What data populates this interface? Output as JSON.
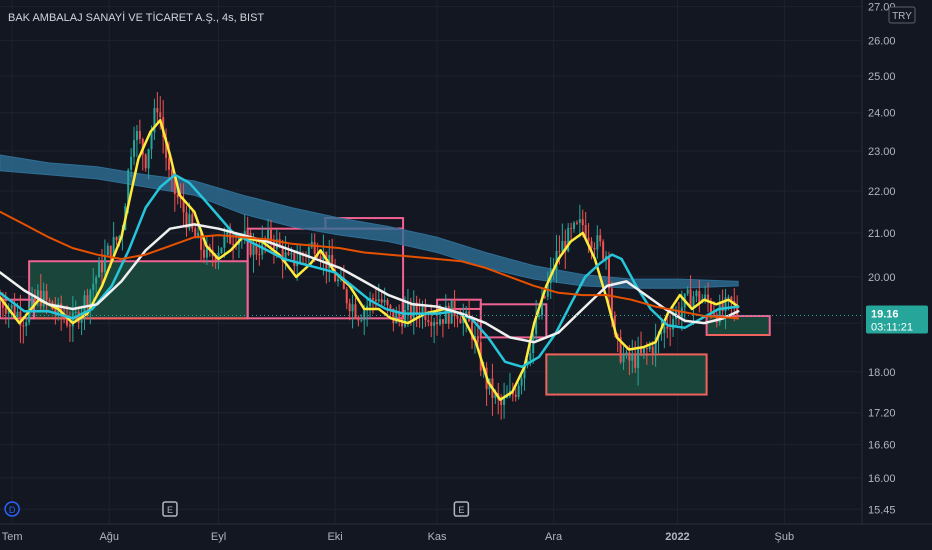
{
  "header": {
    "title": "BAK AMBALAJ SANAYİ VE TİCARET A.Ş., 4s, BIST",
    "currency": "TRY"
  },
  "price_badge": {
    "price": "19.16",
    "countdown": "03:11:21",
    "color": "#26a69a"
  },
  "event_markers": [
    {
      "label": "D",
      "time": 0.5,
      "color": "#2962ff"
    },
    {
      "label": "E",
      "time": 7.0,
      "color": "#b2b5be"
    },
    {
      "label": "E",
      "time": 19.0,
      "color": "#b2b5be"
    }
  ],
  "colors": {
    "background": "#131722",
    "grid": "#1e222d",
    "candle_up": "#26a69a",
    "candle_down": "#ef5350",
    "ma_yellow": "#ffeb3b",
    "ma_cyan": "#26c6da",
    "ma_white": "#f0f0f0",
    "ma_orange": "#e65100",
    "cloud": "#2e6f96",
    "zone_pink": "#f06292",
    "zone_red": "#f0625c",
    "zone_fill": "#1b4d3e"
  },
  "chart_data": {
    "type": "candlestick",
    "title": "BAK AMBALAJ SANAYİ VE TİCARET A.Ş., 4s, BIST",
    "y_scale": "log",
    "ylim": [
      15.2,
      27.2
    ],
    "xlim": [
      0,
      35.5
    ],
    "yticks": [
      "15.45",
      "16.00",
      "16.60",
      "17.20",
      "18.00",
      "19.00",
      "20.00",
      "21.00",
      "22.00",
      "23.00",
      "24.00",
      "25.00",
      "26.00",
      "27.00"
    ],
    "xticks": [
      {
        "label": "Tem",
        "x": 0.5
      },
      {
        "label": "Ağu",
        "x": 4.5
      },
      {
        "label": "Eyl",
        "x": 9.0
      },
      {
        "label": "Eki",
        "x": 13.8
      },
      {
        "label": "Kas",
        "x": 18.0
      },
      {
        "label": "Ara",
        "x": 22.8
      },
      {
        "label": "2022",
        "x": 27.9
      },
      {
        "label": "Şub",
        "x": 32.3
      }
    ],
    "grid": true,
    "last_price": 19.16,
    "ohlc_keypoints": [
      [
        0,
        19.5
      ],
      [
        1.0,
        19.1
      ],
      [
        1.6,
        19.6
      ],
      [
        2.4,
        19.2
      ],
      [
        3.0,
        19.0
      ],
      [
        3.6,
        19.6
      ],
      [
        4.4,
        20.5
      ],
      [
        5.0,
        21.0
      ],
      [
        5.5,
        23.6
      ],
      [
        6.0,
        22.8
      ],
      [
        6.5,
        24.3
      ],
      [
        7.0,
        22.2
      ],
      [
        7.5,
        21.6
      ],
      [
        8.0,
        20.9
      ],
      [
        8.6,
        20.4
      ],
      [
        9.2,
        20.8
      ],
      [
        9.8,
        21.0
      ],
      [
        10.5,
        20.6
      ],
      [
        11.2,
        20.9
      ],
      [
        11.9,
        20.3
      ],
      [
        12.5,
        20.5
      ],
      [
        13.0,
        20.8
      ],
      [
        13.5,
        20.3
      ],
      [
        14.2,
        19.6
      ],
      [
        14.8,
        19.2
      ],
      [
        15.5,
        19.6
      ],
      [
        16.2,
        19.1
      ],
      [
        16.8,
        19.2
      ],
      [
        17.4,
        19.3
      ],
      [
        18.0,
        19.1
      ],
      [
        18.8,
        19.3
      ],
      [
        19.4,
        18.9
      ],
      [
        20.0,
        17.8
      ],
      [
        20.6,
        17.3
      ],
      [
        21.2,
        17.6
      ],
      [
        21.8,
        18.5
      ],
      [
        22.4,
        19.5
      ],
      [
        23.0,
        20.6
      ],
      [
        23.6,
        21.0
      ],
      [
        24.0,
        21.2
      ],
      [
        24.5,
        20.8
      ],
      [
        25.0,
        20.5
      ],
      [
        25.3,
        18.6
      ],
      [
        25.8,
        18.2
      ],
      [
        26.4,
        18.3
      ],
      [
        27.0,
        18.6
      ],
      [
        27.5,
        19.0
      ],
      [
        28.0,
        19.3
      ],
      [
        28.5,
        19.6
      ],
      [
        29.0,
        19.5
      ],
      [
        29.6,
        19.2
      ],
      [
        30.1,
        19.4
      ],
      [
        30.4,
        19.2
      ]
    ],
    "series": [
      {
        "name": "",
        "color": "#ffeb3b",
        "points": [
          [
            0,
            19.55
          ],
          [
            0.8,
            19.0
          ],
          [
            1.6,
            19.5
          ],
          [
            2.4,
            19.3
          ],
          [
            3.0,
            19.0
          ],
          [
            3.6,
            19.2
          ],
          [
            4.2,
            19.8
          ],
          [
            5.0,
            20.9
          ],
          [
            5.7,
            22.8
          ],
          [
            6.2,
            23.5
          ],
          [
            6.6,
            23.8
          ],
          [
            7.0,
            22.9
          ],
          [
            7.4,
            21.9
          ],
          [
            8.0,
            21.5
          ],
          [
            8.5,
            20.7
          ],
          [
            9.0,
            20.4
          ],
          [
            9.5,
            20.6
          ],
          [
            10.0,
            20.9
          ],
          [
            10.8,
            20.8
          ],
          [
            11.5,
            20.5
          ],
          [
            12.2,
            20.0
          ],
          [
            12.8,
            20.3
          ],
          [
            13.2,
            20.6
          ],
          [
            13.8,
            20.1
          ],
          [
            14.4,
            19.8
          ],
          [
            15.0,
            19.3
          ],
          [
            15.6,
            19.3
          ],
          [
            16.1,
            19.1
          ],
          [
            16.8,
            19.0
          ],
          [
            17.5,
            19.2
          ],
          [
            18.3,
            19.3
          ],
          [
            19.0,
            19.2
          ],
          [
            19.6,
            18.6
          ],
          [
            20.1,
            17.8
          ],
          [
            20.6,
            17.45
          ],
          [
            21.1,
            17.6
          ],
          [
            21.6,
            18.1
          ],
          [
            22.0,
            19.0
          ],
          [
            22.5,
            19.8
          ],
          [
            23.0,
            20.4
          ],
          [
            23.5,
            20.8
          ],
          [
            24.0,
            21.0
          ],
          [
            24.5,
            20.4
          ],
          [
            25.0,
            19.5
          ],
          [
            25.4,
            18.7
          ],
          [
            25.9,
            18.45
          ],
          [
            26.5,
            18.5
          ],
          [
            27.0,
            18.6
          ],
          [
            27.5,
            19.2
          ],
          [
            28.0,
            19.6
          ],
          [
            28.5,
            19.3
          ],
          [
            29.0,
            19.5
          ],
          [
            29.5,
            19.4
          ],
          [
            30.0,
            19.5
          ],
          [
            30.4,
            19.35
          ]
        ]
      },
      {
        "name": "",
        "color": "#26c6da",
        "points": [
          [
            0,
            19.65
          ],
          [
            1.0,
            19.25
          ],
          [
            2.0,
            19.25
          ],
          [
            3.0,
            19.1
          ],
          [
            3.8,
            19.3
          ],
          [
            4.6,
            19.8
          ],
          [
            5.3,
            20.6
          ],
          [
            6.0,
            21.6
          ],
          [
            6.6,
            22.1
          ],
          [
            7.2,
            22.4
          ],
          [
            7.8,
            22.2
          ],
          [
            8.4,
            21.8
          ],
          [
            9.0,
            21.4
          ],
          [
            9.6,
            21.0
          ],
          [
            10.3,
            20.8
          ],
          [
            11.0,
            20.6
          ],
          [
            11.7,
            20.4
          ],
          [
            12.4,
            20.3
          ],
          [
            13.1,
            20.2
          ],
          [
            13.8,
            20.1
          ],
          [
            14.5,
            19.8
          ],
          [
            15.2,
            19.5
          ],
          [
            15.9,
            19.3
          ],
          [
            16.6,
            19.2
          ],
          [
            17.3,
            19.2
          ],
          [
            18.0,
            19.2
          ],
          [
            18.7,
            19.25
          ],
          [
            19.4,
            19.1
          ],
          [
            20.1,
            18.7
          ],
          [
            20.8,
            18.2
          ],
          [
            21.5,
            18.1
          ],
          [
            22.2,
            18.3
          ],
          [
            22.9,
            18.8
          ],
          [
            23.5,
            19.4
          ],
          [
            24.1,
            20.0
          ],
          [
            24.7,
            20.3
          ],
          [
            25.2,
            20.5
          ],
          [
            25.6,
            20.4
          ],
          [
            26.2,
            19.8
          ],
          [
            26.8,
            19.3
          ],
          [
            27.5,
            18.95
          ],
          [
            28.2,
            18.9
          ],
          [
            28.9,
            19.1
          ],
          [
            29.6,
            19.3
          ],
          [
            30.4,
            19.35
          ]
        ]
      },
      {
        "name": "",
        "color": "#f0f0f0",
        "points": [
          [
            0,
            20.1
          ],
          [
            1.0,
            19.7
          ],
          [
            2.0,
            19.4
          ],
          [
            3.0,
            19.3
          ],
          [
            4.0,
            19.4
          ],
          [
            5.0,
            19.9
          ],
          [
            6.0,
            20.6
          ],
          [
            7.0,
            21.1
          ],
          [
            8.0,
            21.2
          ],
          [
            9.0,
            21.1
          ],
          [
            10.0,
            20.95
          ],
          [
            11.0,
            20.8
          ],
          [
            12.0,
            20.6
          ],
          [
            13.0,
            20.4
          ],
          [
            14.0,
            20.2
          ],
          [
            15.0,
            19.9
          ],
          [
            16.0,
            19.6
          ],
          [
            17.0,
            19.4
          ],
          [
            18.0,
            19.35
          ],
          [
            19.0,
            19.2
          ],
          [
            20.0,
            19.0
          ],
          [
            21.0,
            18.7
          ],
          [
            22.0,
            18.6
          ],
          [
            23.0,
            18.8
          ],
          [
            24.0,
            19.3
          ],
          [
            25.0,
            19.8
          ],
          [
            25.8,
            19.9
          ],
          [
            26.6,
            19.6
          ],
          [
            27.4,
            19.3
          ],
          [
            28.2,
            19.05
          ],
          [
            29.0,
            19.0
          ],
          [
            29.8,
            19.1
          ],
          [
            30.4,
            19.25
          ]
        ]
      },
      {
        "name": "",
        "color": "#e65100",
        "points": [
          [
            0,
            21.5
          ],
          [
            1.0,
            21.2
          ],
          [
            2.0,
            20.9
          ],
          [
            3.0,
            20.65
          ],
          [
            4.0,
            20.5
          ],
          [
            5.0,
            20.4
          ],
          [
            6.0,
            20.5
          ],
          [
            7.0,
            20.7
          ],
          [
            8.0,
            20.9
          ],
          [
            9.0,
            20.95
          ],
          [
            10.0,
            20.9
          ],
          [
            11.0,
            20.85
          ],
          [
            12.0,
            20.75
          ],
          [
            13.0,
            20.7
          ],
          [
            14.0,
            20.65
          ],
          [
            15.0,
            20.55
          ],
          [
            16.0,
            20.5
          ],
          [
            17.0,
            20.45
          ],
          [
            18.0,
            20.4
          ],
          [
            19.0,
            20.35
          ],
          [
            20.0,
            20.2
          ],
          [
            21.0,
            20.0
          ],
          [
            22.0,
            19.8
          ],
          [
            23.0,
            19.65
          ],
          [
            24.0,
            19.6
          ],
          [
            25.0,
            19.6
          ],
          [
            26.0,
            19.5
          ],
          [
            27.0,
            19.35
          ],
          [
            28.0,
            19.25
          ],
          [
            29.0,
            19.15
          ],
          [
            30.4,
            19.1
          ]
        ]
      }
    ],
    "cloud": {
      "color": "#2e6f96",
      "upper": [
        [
          0,
          22.9
        ],
        [
          2.0,
          22.7
        ],
        [
          4.0,
          22.6
        ],
        [
          6.0,
          22.4
        ],
        [
          8.0,
          22.25
        ],
        [
          10.0,
          21.9
        ],
        [
          12.0,
          21.6
        ],
        [
          14.0,
          21.35
        ],
        [
          16.0,
          21.15
        ],
        [
          18.0,
          20.9
        ],
        [
          20.0,
          20.55
        ],
        [
          22.0,
          20.25
        ],
        [
          24.0,
          20.05
        ],
        [
          26.0,
          19.95
        ],
        [
          28.0,
          19.95
        ],
        [
          30.4,
          19.9
        ]
      ],
      "lower": [
        [
          0,
          22.5
        ],
        [
          2.0,
          22.4
        ],
        [
          4.0,
          22.3
        ],
        [
          6.0,
          22.1
        ],
        [
          8.0,
          21.9
        ],
        [
          10.0,
          21.45
        ],
        [
          12.0,
          21.15
        ],
        [
          14.0,
          20.95
        ],
        [
          16.0,
          20.8
        ],
        [
          18.0,
          20.55
        ],
        [
          20.0,
          20.2
        ],
        [
          22.0,
          19.95
        ],
        [
          24.0,
          19.8
        ],
        [
          26.0,
          19.75
        ],
        [
          28.0,
          19.75
        ],
        [
          30.4,
          19.8
        ]
      ]
    },
    "zones": [
      {
        "x0": 1.2,
        "x1": 10.2,
        "top": 20.35,
        "bottom": 19.1,
        "border": "#f06292",
        "fill": "#1b4d3e",
        "bottom_border": "#f0625c"
      },
      {
        "x0": 0,
        "x1": 1.4,
        "top": 19.5,
        "bottom": 19.1,
        "border": "#f06292",
        "fill": "none"
      },
      {
        "x0": 10.2,
        "x1": 16.6,
        "top": 21.1,
        "bottom": 19.1,
        "border": "#f06292",
        "fill": "none"
      },
      {
        "x0": 13.4,
        "x1": 16.6,
        "top": 21.35,
        "bottom": 21.1,
        "border": "#f06292",
        "fill": "none"
      },
      {
        "x0": 18.0,
        "x1": 19.8,
        "top": 19.5,
        "bottom": 19.3,
        "border": "#f06292",
        "fill": "none"
      },
      {
        "x0": 19.8,
        "x1": 22.5,
        "top": 19.4,
        "bottom": 18.7,
        "border": "#f06292",
        "fill": "none"
      },
      {
        "x0": 22.5,
        "x1": 29.1,
        "top": 18.35,
        "bottom": 17.55,
        "border": "#f0625c",
        "fill": "#1b4d3e"
      },
      {
        "x0": 29.1,
        "x1": 31.7,
        "top": 19.15,
        "bottom": 18.75,
        "border": "#f06292",
        "fill": "#1b4d3e",
        "bottom_border": "#f0625c"
      }
    ]
  }
}
